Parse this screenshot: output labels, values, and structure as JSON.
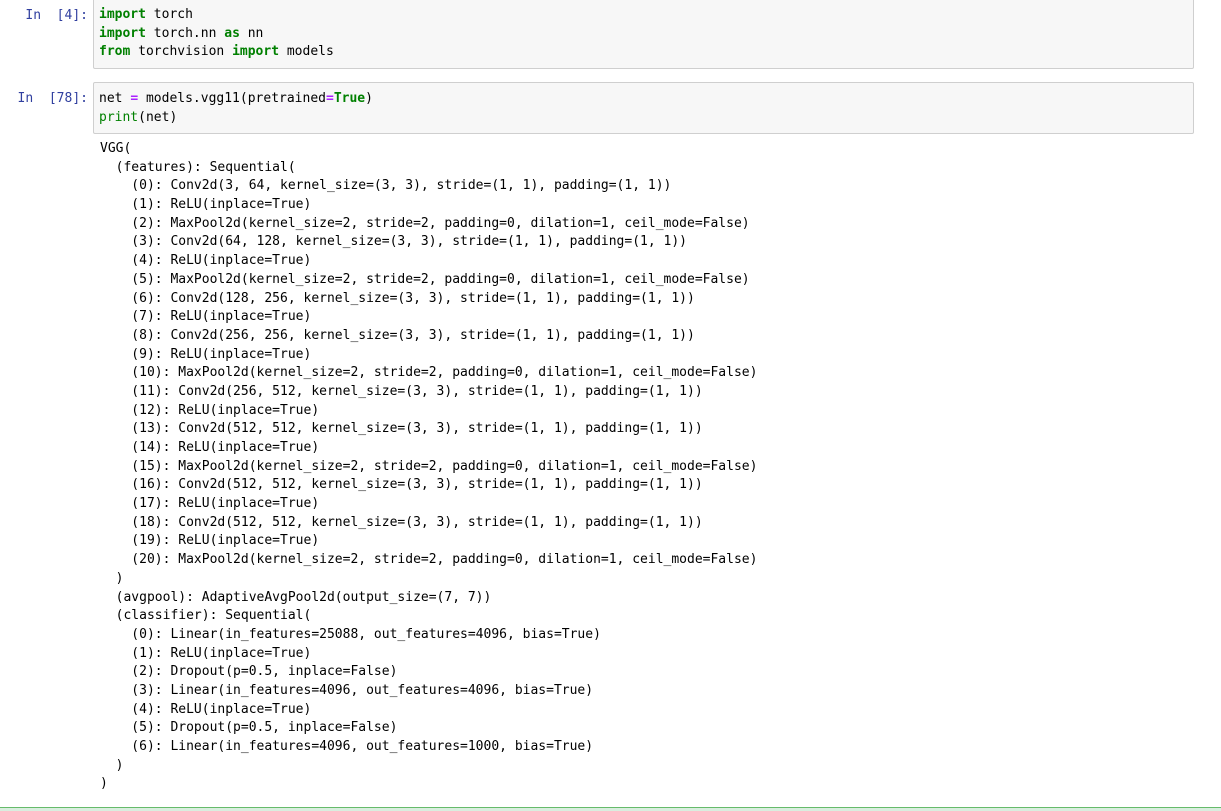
{
  "cells": [
    {
      "prompt": "In  [4]:",
      "lines": [
        [
          {
            "t": "import",
            "c": "kw"
          },
          {
            "t": " torch",
            "c": ""
          }
        ],
        [
          {
            "t": "import",
            "c": "kw"
          },
          {
            "t": " torch.nn ",
            "c": ""
          },
          {
            "t": "as",
            "c": "kw"
          },
          {
            "t": " nn",
            "c": ""
          }
        ],
        [
          {
            "t": "from",
            "c": "kw"
          },
          {
            "t": " torchvision ",
            "c": ""
          },
          {
            "t": "import",
            "c": "kw"
          },
          {
            "t": " models",
            "c": ""
          }
        ]
      ]
    },
    {
      "prompt": "In  [78]:",
      "lines": [
        [
          {
            "t": "net ",
            "c": ""
          },
          {
            "t": "=",
            "c": "op"
          },
          {
            "t": " models.vgg11(pretrained",
            "c": ""
          },
          {
            "t": "=",
            "c": "op"
          },
          {
            "t": "True",
            "c": "kw"
          },
          {
            "t": ")",
            "c": ""
          }
        ],
        [
          {
            "t": "print",
            "c": "bi"
          },
          {
            "t": "(net)",
            "c": ""
          }
        ]
      ]
    }
  ],
  "output_lines": [
    "VGG(",
    "  (features): Sequential(",
    "    (0): Conv2d(3, 64, kernel_size=(3, 3), stride=(1, 1), padding=(1, 1))",
    "    (1): ReLU(inplace=True)",
    "    (2): MaxPool2d(kernel_size=2, stride=2, padding=0, dilation=1, ceil_mode=False)",
    "    (3): Conv2d(64, 128, kernel_size=(3, 3), stride=(1, 1), padding=(1, 1))",
    "    (4): ReLU(inplace=True)",
    "    (5): MaxPool2d(kernel_size=2, stride=2, padding=0, dilation=1, ceil_mode=False)",
    "    (6): Conv2d(128, 256, kernel_size=(3, 3), stride=(1, 1), padding=(1, 1))",
    "    (7): ReLU(inplace=True)",
    "    (8): Conv2d(256, 256, kernel_size=(3, 3), stride=(1, 1), padding=(1, 1))",
    "    (9): ReLU(inplace=True)",
    "    (10): MaxPool2d(kernel_size=2, stride=2, padding=0, dilation=1, ceil_mode=False)",
    "    (11): Conv2d(256, 512, kernel_size=(3, 3), stride=(1, 1), padding=(1, 1))",
    "    (12): ReLU(inplace=True)",
    "    (13): Conv2d(512, 512, kernel_size=(3, 3), stride=(1, 1), padding=(1, 1))",
    "    (14): ReLU(inplace=True)",
    "    (15): MaxPool2d(kernel_size=2, stride=2, padding=0, dilation=1, ceil_mode=False)",
    "    (16): Conv2d(512, 512, kernel_size=(3, 3), stride=(1, 1), padding=(1, 1))",
    "    (17): ReLU(inplace=True)",
    "    (18): Conv2d(512, 512, kernel_size=(3, 3), stride=(1, 1), padding=(1, 1))",
    "    (19): ReLU(inplace=True)",
    "    (20): MaxPool2d(kernel_size=2, stride=2, padding=0, dilation=1, ceil_mode=False)",
    "  )",
    "  (avgpool): AdaptiveAvgPool2d(output_size=(7, 7))",
    "  (classifier): Sequential(",
    "    (0): Linear(in_features=25088, out_features=4096, bias=True)",
    "    (1): ReLU(inplace=True)",
    "    (2): Dropout(p=0.5, inplace=False)",
    "    (3): Linear(in_features=4096, out_features=4096, bias=True)",
    "    (4): ReLU(inplace=True)",
    "    (5): Dropout(p=0.5, inplace=False)",
    "    (6): Linear(in_features=4096, out_features=1000, bias=True)",
    "  )",
    ")"
  ],
  "colors": {
    "prompt": "#303f9f",
    "keyword": "#008000",
    "operator": "#aa22ff",
    "input_bg": "#f7f7f7",
    "input_border": "#cfcfcf"
  }
}
